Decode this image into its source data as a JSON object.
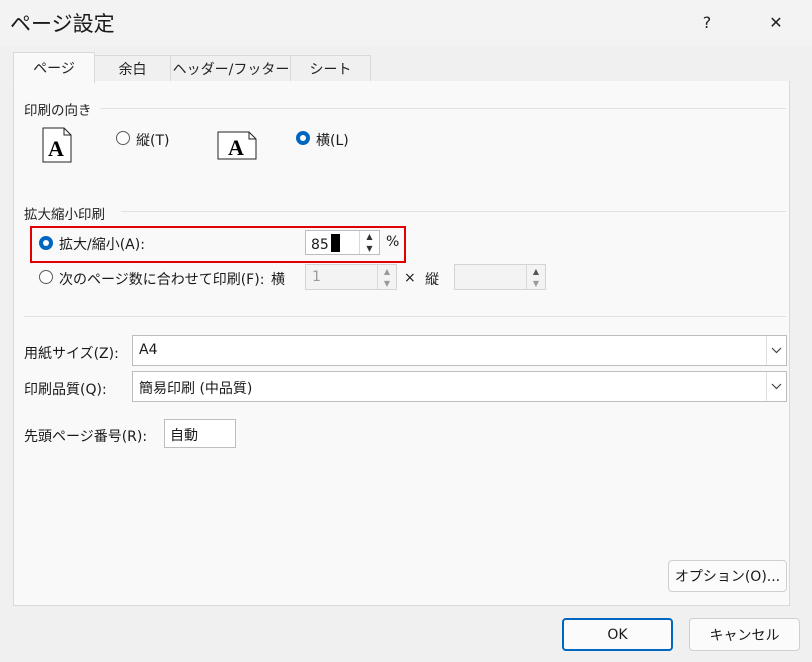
{
  "window": {
    "title": "ページ設定",
    "help_label": "?",
    "close_label": "✕"
  },
  "tabs": [
    {
      "label": "ページ",
      "active": true
    },
    {
      "label": "余白",
      "active": false
    },
    {
      "label": "ヘッダー/フッター",
      "active": false
    },
    {
      "label": "シート",
      "active": false
    }
  ],
  "orientation": {
    "section_label": "印刷の向き",
    "portrait": {
      "label": "縦(T)",
      "selected": false,
      "icon_glyph": "A"
    },
    "landscape": {
      "label": "横(L)",
      "selected": true,
      "icon_glyph": "A"
    }
  },
  "scaling": {
    "section_label": "拡大縮小印刷",
    "adjust": {
      "label": "拡大/縮小(A):",
      "selected": true,
      "value": "85",
      "unit": "%"
    },
    "fit": {
      "label": "次のページ数に合わせて印刷(F):",
      "selected": false,
      "wide_label": "横",
      "wide_value": "1",
      "times": "×",
      "tall_label": "縦",
      "tall_value": ""
    }
  },
  "paper_size": {
    "label": "用紙サイズ(Z):",
    "value": "A4"
  },
  "print_quality": {
    "label": "印刷品質(Q):",
    "value": "簡易印刷 (中品質)"
  },
  "first_page": {
    "label": "先頭ページ番号(R):",
    "value": "自動"
  },
  "buttons": {
    "options": "オプション(O)...",
    "ok": "OK",
    "cancel": "キャンセル"
  },
  "colors": {
    "accent": "#0067c0",
    "highlight_box": "#e00000"
  }
}
